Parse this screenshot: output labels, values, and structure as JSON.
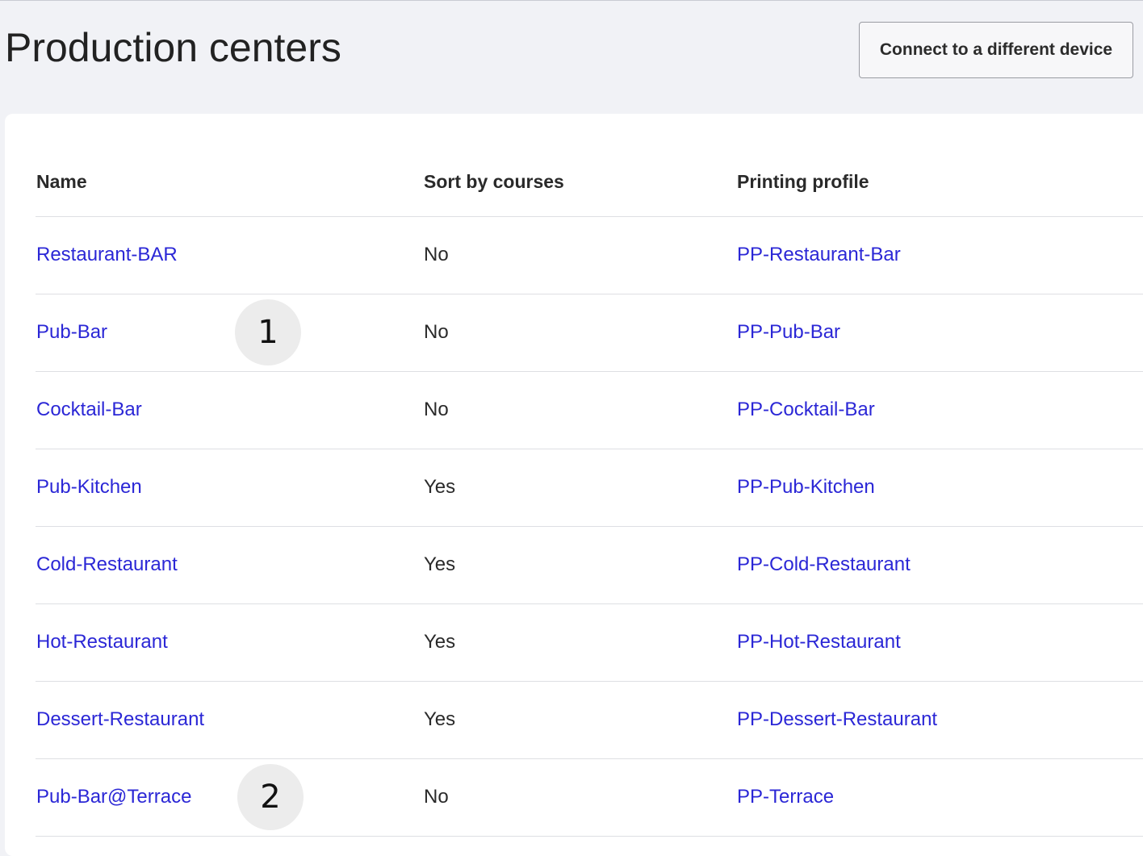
{
  "page": {
    "title": "Production centers",
    "connect_button_label": "Connect to a different device"
  },
  "table": {
    "columns": [
      "Name",
      "Sort by courses",
      "Printing profile"
    ],
    "rows": [
      {
        "name": "Restaurant-BAR",
        "sort_by_courses": "No",
        "printing_profile": "PP-Restaurant-Bar"
      },
      {
        "name": "Pub-Bar",
        "sort_by_courses": "No",
        "printing_profile": "PP-Pub-Bar"
      },
      {
        "name": "Cocktail-Bar",
        "sort_by_courses": "No",
        "printing_profile": "PP-Cocktail-Bar"
      },
      {
        "name": "Pub-Kitchen",
        "sort_by_courses": "Yes",
        "printing_profile": "PP-Pub-Kitchen"
      },
      {
        "name": "Cold-Restaurant",
        "sort_by_courses": "Yes",
        "printing_profile": "PP-Cold-Restaurant"
      },
      {
        "name": "Hot-Restaurant",
        "sort_by_courses": "Yes",
        "printing_profile": "PP-Hot-Restaurant"
      },
      {
        "name": "Dessert-Restaurant",
        "sort_by_courses": "Yes",
        "printing_profile": "PP-Dessert-Restaurant"
      },
      {
        "name": "Pub-Bar@Terrace",
        "sort_by_courses": "No",
        "printing_profile": "PP-Terrace"
      }
    ]
  },
  "annotations": [
    "1",
    "2"
  ],
  "colors": {
    "page_background": "#f1f2f6",
    "card_background": "#ffffff",
    "link": "#2b27d6",
    "divider": "#dedfe3",
    "badge_background": "#ececec"
  }
}
